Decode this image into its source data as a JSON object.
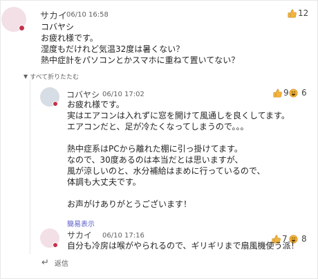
{
  "post": {
    "author": "サカイ",
    "time": "06/10 16:58",
    "lines": [
      "コバヤシ",
      "お疲れ様です。",
      "湿度もだけれど気温32度は暑くない？",
      "熱中症計をパソコンとかスマホに重ねて置いてない？"
    ],
    "reactions": [
      {
        "icon": "thumbs-up-icon",
        "count": "12"
      }
    ]
  },
  "collapse_label": "すべて折りたたむ",
  "replies": [
    {
      "author": "コバヤシ",
      "time": "06/10 17:02",
      "lines": [
        "お疲れ様です。",
        "実はエアコンは入れずに窓を開けて風通しを良くしてます。",
        "エアコンだと、足が冷たくなってしまうので。。。",
        "",
        "熱中症系はPCから離れた棚に引っ掛けてます。",
        "なので、30度あるのは本当だとは思いますが、",
        "風が涼しいのと、水分補給はまめに行っているので、",
        "体調も大丈夫です。",
        "",
        "お声がけありがとうございます！"
      ],
      "reactions": [
        {
          "icon": "thumbs-up-icon",
          "count": "9"
        },
        {
          "icon": "laugh-icon",
          "count": "6"
        }
      ],
      "show_less": "簡易表示"
    },
    {
      "author": "サカイ",
      "time": "06/10 17:16",
      "lines": [
        "自分も冷房は喉がやられるので、ギリギリまで扇風機使う派！"
      ],
      "reactions": [
        {
          "icon": "thumbs-up-icon",
          "count": "7"
        },
        {
          "icon": "laugh-icon",
          "count": "8"
        }
      ]
    }
  ],
  "reply_label": "返信",
  "colors": {
    "accent": "#5b5fc7",
    "presence_busy": "#c4314b",
    "like_gold": "#f3b33d",
    "text": "#242424"
  }
}
